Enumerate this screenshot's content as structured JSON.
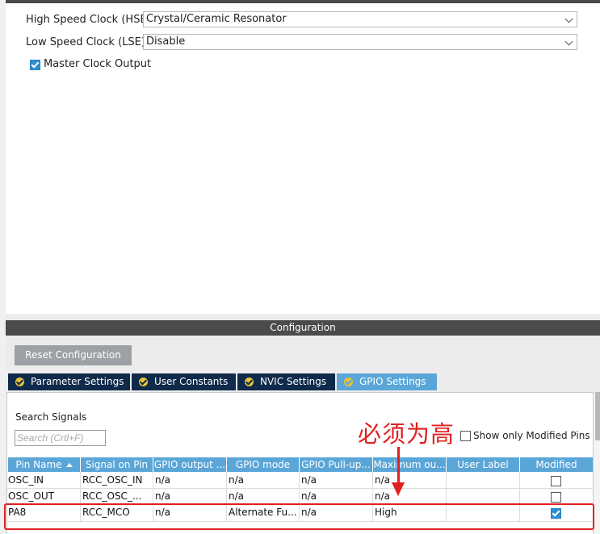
{
  "mode": {
    "hse_label": "High Speed Clock (HSE)",
    "hse_value": "Crystal/Ceramic Resonator",
    "lse_label": "Low Speed Clock (LSE)",
    "lse_value": "Disable",
    "mco_label": "Master Clock Output",
    "mco_checked": true
  },
  "config": {
    "header": "Configuration",
    "reset_button": "Reset Configuration",
    "tabs": [
      {
        "label": "Parameter Settings",
        "active": false
      },
      {
        "label": "User Constants",
        "active": false
      },
      {
        "label": "NVIC Settings",
        "active": false
      },
      {
        "label": "GPIO Settings",
        "active": true
      }
    ]
  },
  "gpio": {
    "search_label": "Search Signals",
    "search_placeholder": "Search (Crtl+F)",
    "show_modified_label": "Show only Modified Pins",
    "columns": [
      "Pin Name",
      "Signal on Pin",
      "GPIO output ...",
      "GPIO mode",
      "GPIO Pull-up...",
      "Maximum ou...",
      "User Label",
      "Modified"
    ],
    "rows": [
      {
        "pin": "OSC_IN",
        "signal": "RCC_OSC_IN",
        "output": "n/a",
        "mode": "n/a",
        "pull": "n/a",
        "speed": "n/a",
        "label": "",
        "modified": false
      },
      {
        "pin": "OSC_OUT",
        "signal": "RCC_OSC_...",
        "output": "n/a",
        "mode": "n/a",
        "pull": "n/a",
        "speed": "n/a",
        "label": "",
        "modified": false
      },
      {
        "pin": "PA8",
        "signal": "RCC_MCO",
        "output": "n/a",
        "mode": "Alternate Fu...",
        "pull": "n/a",
        "speed": "High",
        "label": "",
        "modified": true
      }
    ]
  },
  "annotation": {
    "text": "必须为高",
    "color": "#e02020"
  },
  "colors": {
    "accent": "#5aa6d8",
    "tab_dark": "#0f2a4a",
    "header_dark": "#4b4b4b"
  }
}
